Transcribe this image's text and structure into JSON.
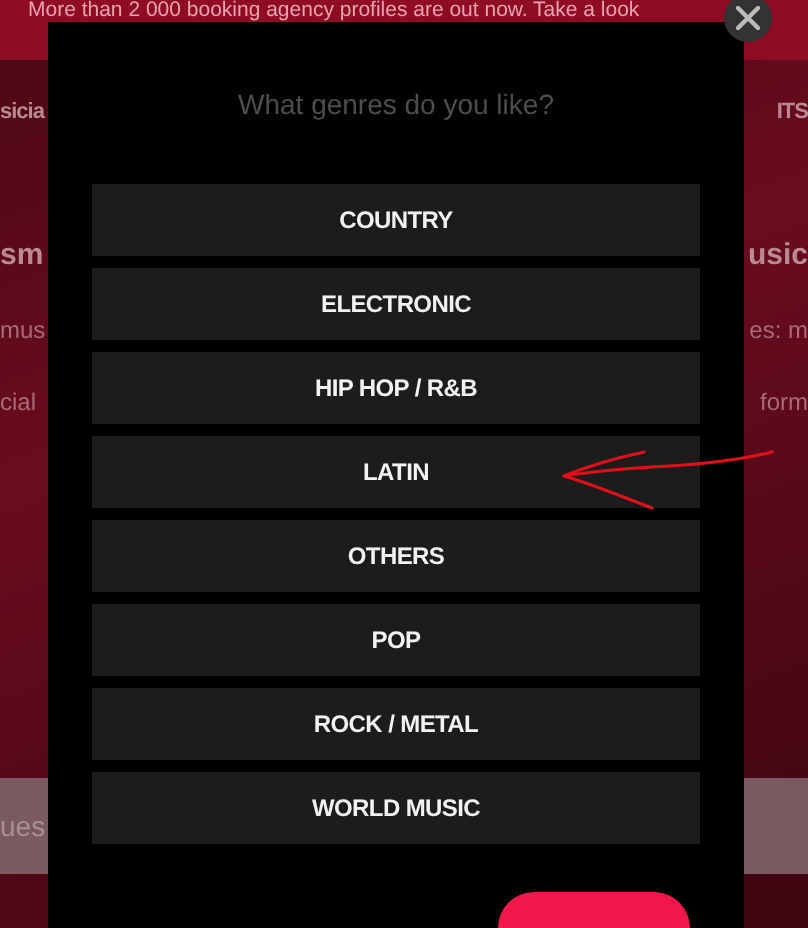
{
  "banner": {
    "text": "More than 2 000 booking agency profiles are out now. Take a look"
  },
  "background_rows": [
    {
      "kind": "nav",
      "left": "sicia",
      "right": "ITS"
    },
    {
      "kind": "headline",
      "left": "sm",
      "right": "usic"
    },
    {
      "kind": "body",
      "left": "mus",
      "right": "es: m"
    },
    {
      "kind": "body",
      "left": "cial",
      "right": "form"
    }
  ],
  "search_bar": {
    "text": "ues"
  },
  "modal": {
    "title": "What genres do you like?",
    "genres": [
      "COUNTRY",
      "ELECTRONIC",
      "HIP HOP / R&B",
      "LATIN",
      "OTHERS",
      "POP",
      "ROCK / METAL",
      "WORLD MUSIC"
    ]
  }
}
